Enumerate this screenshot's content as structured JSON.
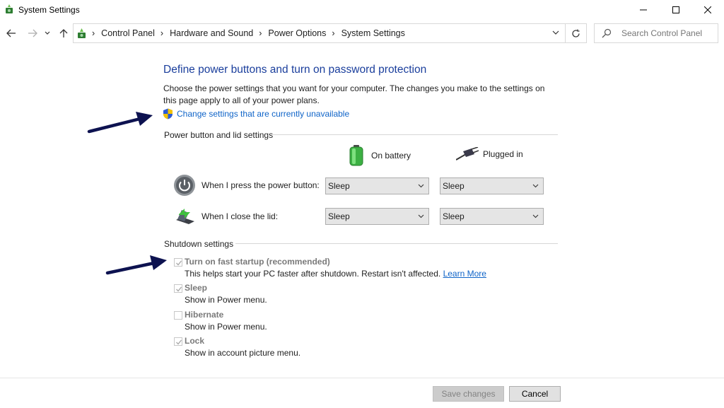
{
  "window": {
    "title": "System Settings",
    "minimize_icon": "minimize-icon",
    "maximize_icon": "maximize-icon",
    "close_icon": "close-icon"
  },
  "nav": {
    "breadcrumbs": [
      {
        "label": "Control Panel"
      },
      {
        "label": "Hardware and Sound"
      },
      {
        "label": "Power Options"
      },
      {
        "label": "System Settings"
      }
    ],
    "search_placeholder": "Search Control Panel"
  },
  "page": {
    "heading": "Define power buttons and turn on password protection",
    "description": "Choose the power settings that you want for your computer. The changes you make to the settings on this page apply to all of your power plans.",
    "change_link": "Change settings that are currently unavailable"
  },
  "power_section": {
    "title": "Power button and lid settings",
    "col_battery": "On battery",
    "col_plugged": "Plugged in",
    "rows": [
      {
        "label": "When I press the power button:",
        "battery": "Sleep",
        "plugged": "Sleep"
      },
      {
        "label": "When I close the lid:",
        "battery": "Sleep",
        "plugged": "Sleep"
      }
    ]
  },
  "shutdown_section": {
    "title": "Shutdown settings",
    "options": [
      {
        "label": "Turn on fast startup (recommended)",
        "sub": "This helps start your PC faster after shutdown. Restart isn't affected.",
        "link": "Learn More",
        "checked": true
      },
      {
        "label": "Sleep",
        "sub": "Show in Power menu.",
        "checked": true
      },
      {
        "label": "Hibernate",
        "sub": "Show in Power menu.",
        "checked": false
      },
      {
        "label": "Lock",
        "sub": "Show in account picture menu.",
        "checked": true
      }
    ]
  },
  "footer": {
    "save_label": "Save changes",
    "cancel_label": "Cancel"
  },
  "colors": {
    "heading": "#1a3e9c",
    "link": "#0f64c8",
    "annotation_arrow": "#0d1250"
  }
}
